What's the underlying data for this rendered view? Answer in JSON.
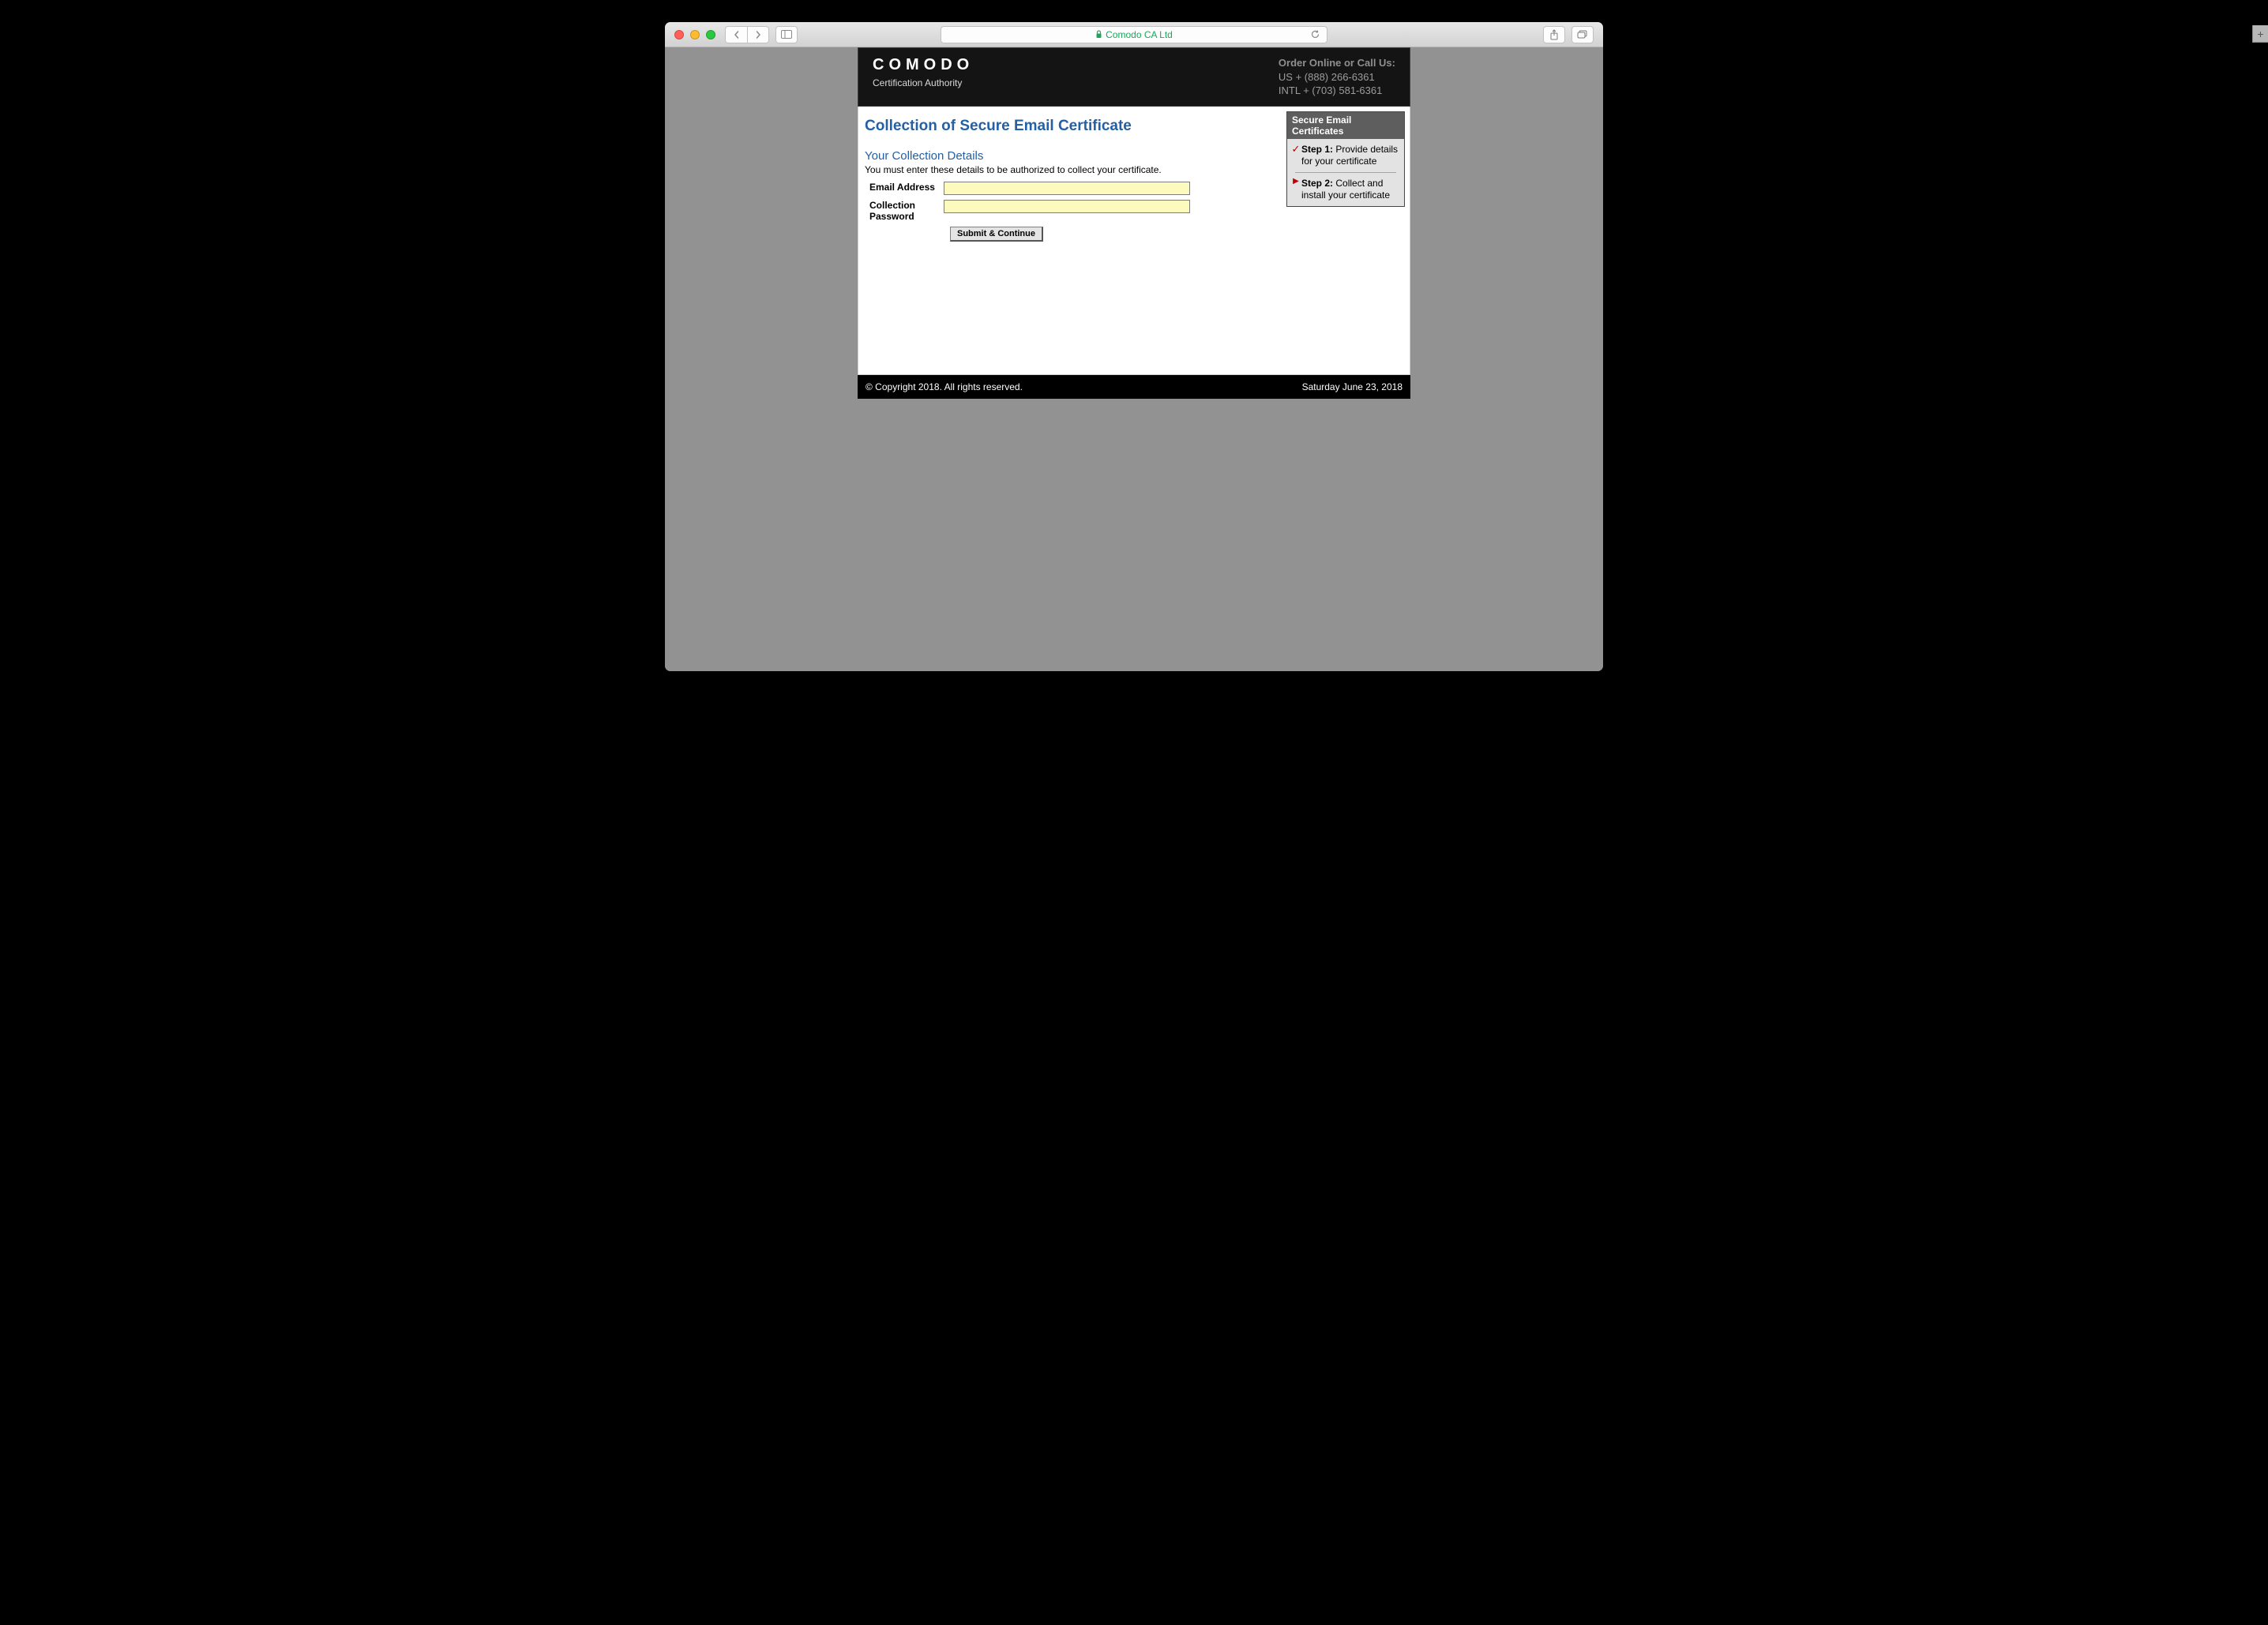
{
  "browser": {
    "url_label": "Comodo CA Ltd"
  },
  "header": {
    "brand": "COMODO",
    "brand_sub": "Certification Authority",
    "contact_title": "Order Online or Call Us:",
    "contact_us": "US + (888) 266-6361",
    "contact_intl": "INTL + (703) 581-6361"
  },
  "main": {
    "page_title": "Collection of Secure Email Certificate",
    "sub_title": "Your Collection Details",
    "instruction": "You must enter these details to be authorized to collect your certificate.",
    "email_label": "Email Address",
    "email_value": "",
    "password_label": "Collection Password",
    "password_value": "",
    "submit_label": "Submit & Continue"
  },
  "steps": {
    "title": "Secure Email Certificates",
    "step1_label": "Step 1:",
    "step1_text": " Provide details for your certificate",
    "step2_label": "Step 2:",
    "step2_text": " Collect and install your certificate"
  },
  "footer": {
    "copyright": "© Copyright 2018. All rights reserved.",
    "date": "Saturday June 23, 2018"
  }
}
